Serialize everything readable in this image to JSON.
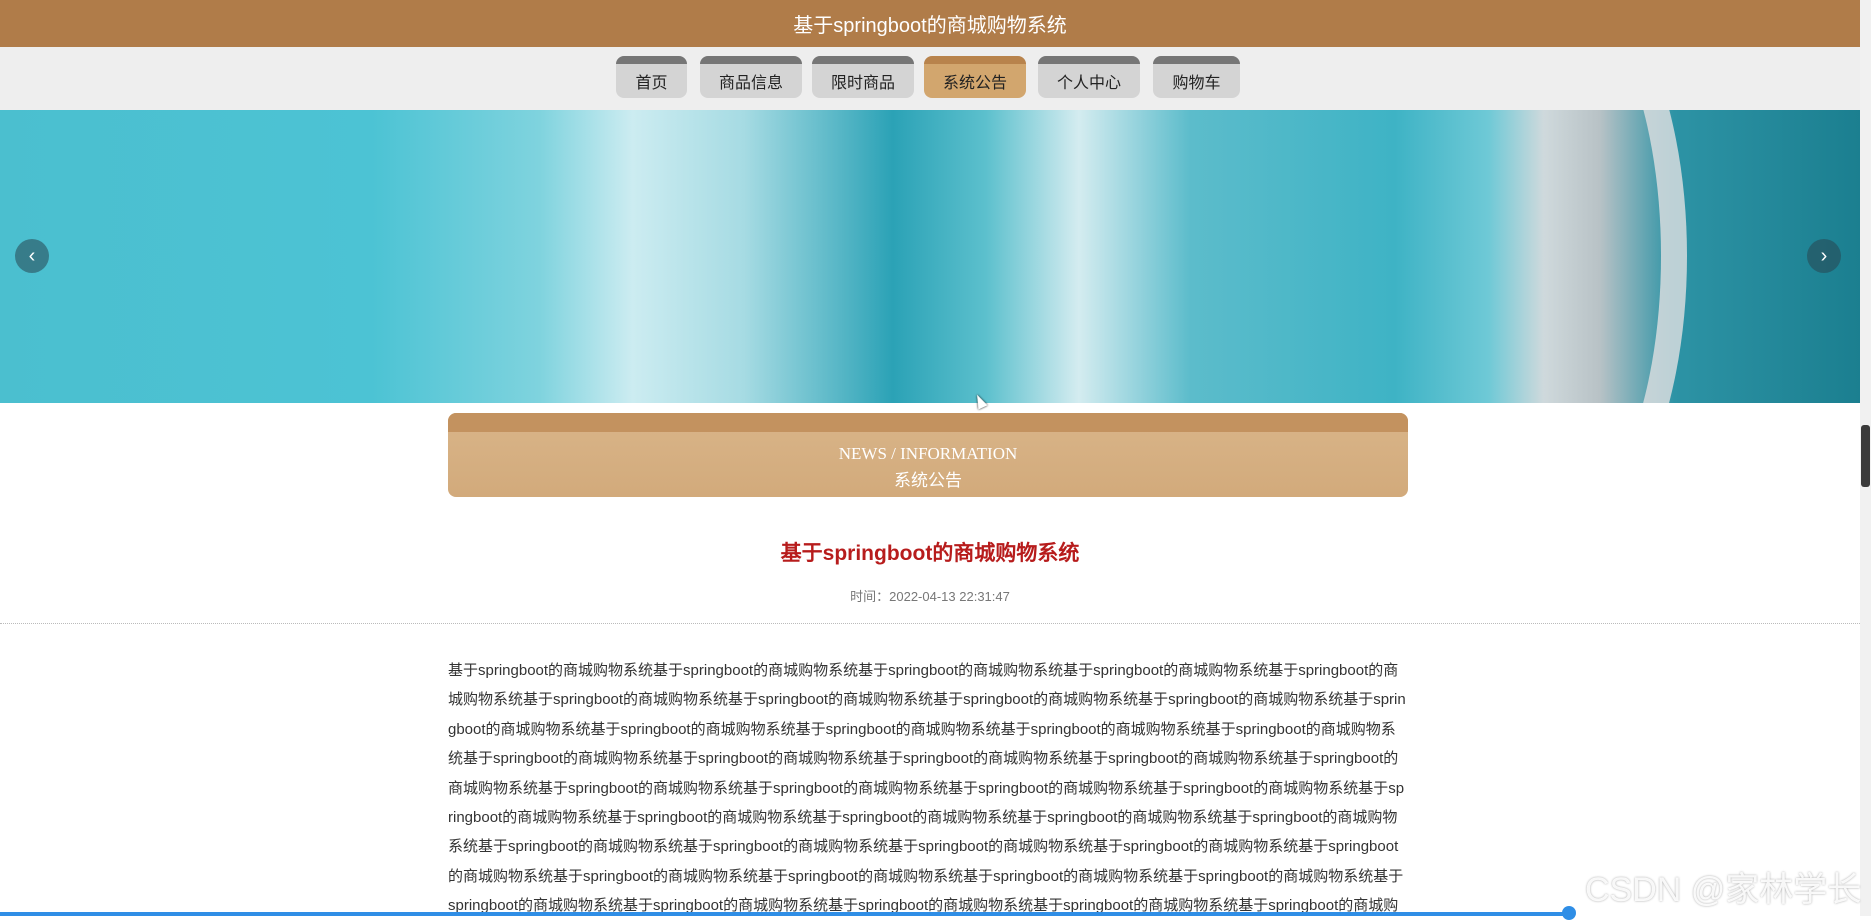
{
  "header": {
    "title": "基于springboot的商城购物系统"
  },
  "nav": {
    "items": [
      {
        "label": "首页"
      },
      {
        "label": "商品信息"
      },
      {
        "label": "限时商品"
      },
      {
        "label": "系统公告",
        "active": true
      },
      {
        "label": "个人中心"
      },
      {
        "label": "购物车"
      }
    ]
  },
  "banner": {
    "prev_icon": "chevron-left-icon",
    "next_icon": "chevron-right-icon",
    "prev_glyph": "‹",
    "next_glyph": "›"
  },
  "section": {
    "title_en": "NEWS / INFORMATION",
    "title_cn": "系统公告"
  },
  "article": {
    "title": "基于springboot的商城购物系统",
    "time": "时间：2022-04-13 22:31:47",
    "body": "基于springboot的商城购物系统基于springboot的商城购物系统基于springboot的商城购物系统基于springboot的商城购物系统基于springboot的商城购物系统基于springboot的商城购物系统基于springboot的商城购物系统基于springboot的商城购物系统基于springboot的商城购物系统基于springboot的商城购物系统基于springboot的商城购物系统基于springboot的商城购物系统基于springboot的商城购物系统基于springboot的商城购物系统基于springboot的商城购物系统基于springboot的商城购物系统基于springboot的商城购物系统基于springboot的商城购物系统基于springboot的商城购物系统基于springboot的商城购物系统基于springboot的商城购物系统基于springboot的商城购物系统基于springboot的商城购物系统基于springboot的商城购物系统基于springboot的商城购物系统基于springboot的商城购物系统基于springboot的商城购物系统基于springboot的商城购物系统基于springboot的商城购物系统基于springboot的商城购物系统基于springboot的商城购物系统基于springboot的商城购物系统基于springboot的商城购物系统基于springboot的商城购物系统基于springboot的商城购物系统基于springboot的商城购物系统基于springboot的商城购物系统基于springboot的商城购物系统基于springboot的商城购物系统基于springboot的商城购物系统基于springboot的商城购物系统基于springboot的商城购物系统基于springboot的商城购物系统基于springboot的商城购物系统基于springboot的商城购物系统基于springboot的商城购物系统基于springboot的商城购物系统基于springboot的商城购物系统基于s"
  },
  "watermark": "CSDN @家林学长"
}
